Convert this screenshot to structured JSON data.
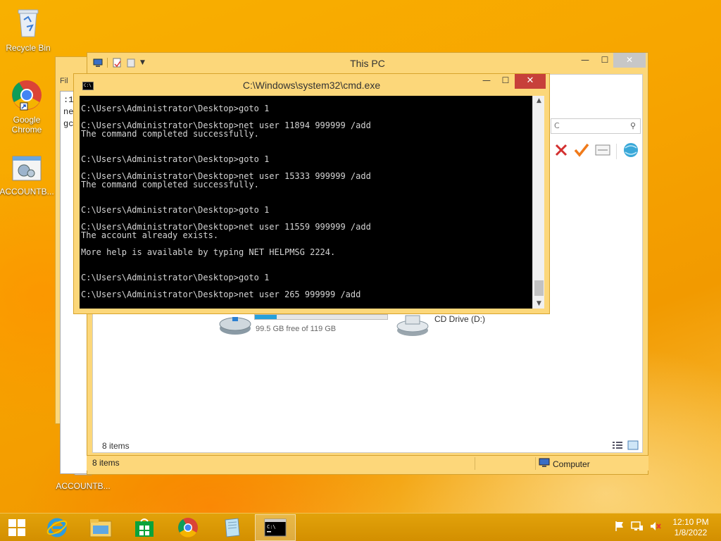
{
  "desktop": {
    "icons": [
      {
        "label": "Recycle Bin"
      },
      {
        "label": "Google Chrome"
      },
      {
        "label": "ACCOUNTB..."
      },
      {
        "label": "ACCOUNTB..."
      }
    ]
  },
  "notepad": {
    "menu_label": "Fil",
    "lines": [
      ":1",
      "ne",
      "gc"
    ]
  },
  "explorer": {
    "title": "This PC",
    "search_placeholder": "C",
    "drive_free": "99.5 GB free of 119 GB",
    "drive_used_fraction": 0.164,
    "cd_drive_label": "CD Drive (D:)",
    "items_count": "8 items",
    "status_items": "8 items",
    "status_computer": "Computer"
  },
  "cmd": {
    "title": "C:\\Windows\\system32\\cmd.exe",
    "lines": [
      "C:\\Users\\Administrator\\Desktop>goto 1",
      "",
      "C:\\Users\\Administrator\\Desktop>net user 11894 999999 /add",
      "The command completed successfully.",
      "",
      "",
      "C:\\Users\\Administrator\\Desktop>goto 1",
      "",
      "C:\\Users\\Administrator\\Desktop>net user 15333 999999 /add",
      "The command completed successfully.",
      "",
      "",
      "C:\\Users\\Administrator\\Desktop>goto 1",
      "",
      "C:\\Users\\Administrator\\Desktop>net user 11559 999999 /add",
      "The account already exists.",
      "",
      "More help is available by typing NET HELPMSG 2224.",
      "",
      "",
      "C:\\Users\\Administrator\\Desktop>goto 1",
      "",
      "C:\\Users\\Administrator\\Desktop>net user 265 999999 /add"
    ]
  },
  "taskbar": {
    "time": "12:10 PM",
    "date": "1/8/2022"
  },
  "colors": {
    "accent": "#f5a400",
    "cmd_close": "#c7403a",
    "drive_fill": "#26a0da"
  }
}
